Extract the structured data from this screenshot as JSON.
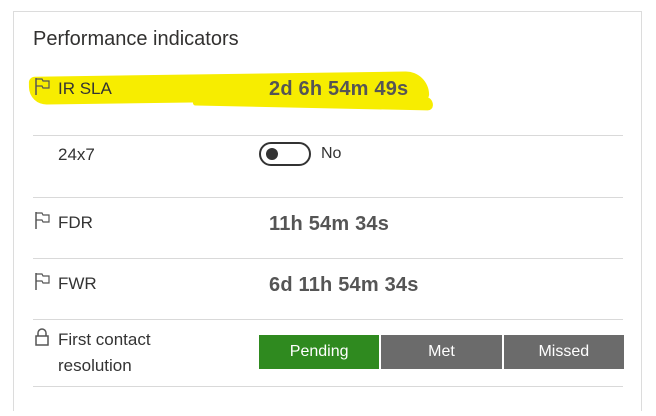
{
  "card": {
    "title": "Performance indicators"
  },
  "indicators": [
    {
      "icon": "flag-icon",
      "label": "IR SLA",
      "value": "2d 6h 54m 49s",
      "highlighted": true
    },
    {
      "label": "24x7",
      "toggle": {
        "state": "off",
        "label": "No"
      }
    },
    {
      "icon": "flag-icon",
      "label": "FDR",
      "value": "11h 54m 34s"
    },
    {
      "icon": "flag-icon",
      "label": "FWR",
      "value": "6d 11h 54m 34s"
    },
    {
      "icon": "lock-icon",
      "label_line1": "First contact",
      "label_line2": "resolution"
    }
  ],
  "resolution_options": [
    "Pending",
    "Met",
    "Missed"
  ],
  "selected_option": "Pending",
  "colors": {
    "highlight": "#f7ed00",
    "active_segment": "#2f8a1f",
    "inactive_segment": "#6b6b6b",
    "value_text": "#555555"
  }
}
